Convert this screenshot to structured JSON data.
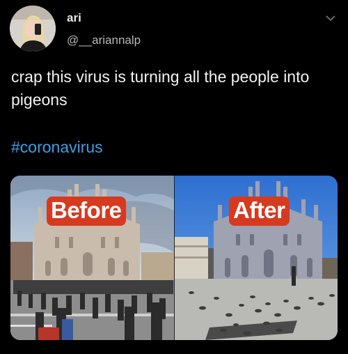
{
  "tweet": {
    "display_name": "ari",
    "handle": "@__ariannalp",
    "text": "crap this virus is turning all the people into pigeons",
    "hashtag": "#coronavirus"
  },
  "media": {
    "left_label": "Before",
    "right_label": "After"
  },
  "colors": {
    "background": "#000000",
    "hashtag": "#3aa0e8",
    "label_bg": "#d63a1f"
  },
  "icons": {
    "menu": "chevron-down-icon"
  }
}
